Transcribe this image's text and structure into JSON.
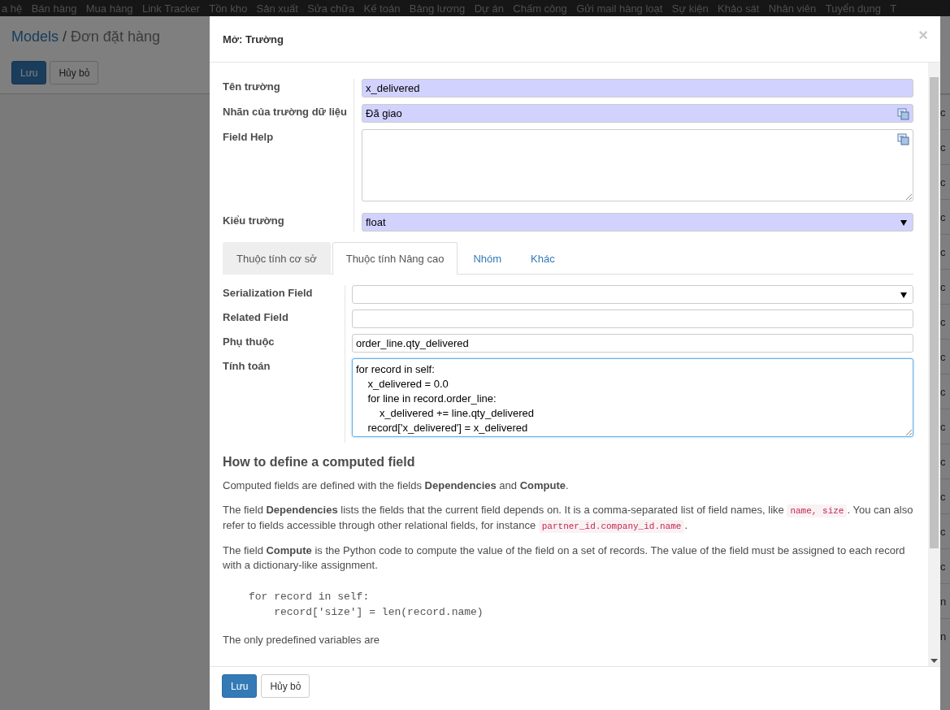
{
  "navbar": {
    "items": [
      "a hệ",
      "Bán hàng",
      "Mua hàng",
      "Link Tracker",
      "Tồn kho",
      "Sản xuất",
      "Sửa chữa",
      "Kế toán",
      "Bảng lương",
      "Dự án",
      "Chấm công",
      "Gửi mail hàng loạt",
      "Sự kiện",
      "Khảo sát",
      "Nhân viên",
      "Tuyển dụng",
      "T"
    ]
  },
  "breadcrumb": {
    "items": [
      {
        "label": "Models",
        "link": true
      },
      {
        "label": "Đơn đặt hàng",
        "link": false
      }
    ],
    "separator": "/"
  },
  "page_buttons": [
    {
      "label": "Lưu",
      "kind": "primary"
    },
    {
      "label": "Hủy bỏ",
      "kind": "secondary"
    }
  ],
  "list_rows": [
    "c",
    "c",
    "c",
    "c",
    "c",
    "c",
    "c",
    "c",
    "c",
    "c",
    "c",
    "c",
    "c",
    "c",
    "n",
    "n"
  ],
  "dialog": {
    "title": "Mở: Trường",
    "close": "×",
    "fields": [
      {
        "label": "Tên trường",
        "kind": "text",
        "value": "x_delivered",
        "required": true,
        "translatable": false
      },
      {
        "label": "Nhãn của trường dữ liệu",
        "kind": "text",
        "value": "Đã giao",
        "required": true,
        "translatable": true
      },
      {
        "label": "Field Help",
        "kind": "textarea",
        "required": false,
        "translatable": true
      },
      {
        "label": "Kiểu trường",
        "kind": "select",
        "value": "float",
        "required": true,
        "translatable": false
      }
    ],
    "tabs": [
      {
        "label": "Thuộc tính cơ sở",
        "selected": false,
        "hovered": true
      },
      {
        "label": "Thuộc tính Nâng cao",
        "selected": true,
        "hovered": false
      },
      {
        "label": "Nhóm",
        "selected": false,
        "hovered": false
      },
      {
        "label": "Khác",
        "selected": false,
        "hovered": false
      }
    ],
    "tab_fields": [
      {
        "label": "Serialization Field",
        "kind": "select",
        "focused": false
      },
      {
        "label": "Related Field",
        "kind": "text",
        "focused": false
      },
      {
        "label": "Phụ thuộc",
        "kind": "text",
        "value": "order_line.qty_delivered",
        "focused": false
      },
      {
        "label": "Tính toán",
        "kind": "textarea",
        "value": "for record in self:\n    x_delivered = 0.0\n    for line in record.order_line:\n        x_delivered += line.qty_delivered\n    record['x_delivered'] = x_delivered",
        "focused": true
      }
    ],
    "help": {
      "title": "How to define a computed field",
      "blocks": [
        {
          "kind": "paragraph",
          "parts": [
            {
              "text": "Computed fields are defined with the fields **Dependencies** and **Compute**."
            }
          ]
        },
        {
          "kind": "paragraph",
          "parts": [
            {
              "text": "The field **Dependencies** lists the fields that the current field depends on. It is a comma-separated list of field names, like "
            },
            {
              "code": "name, size"
            },
            {
              "text": ". You can also refer to fields accessible through other relational fields, for instance "
            },
            {
              "code": "partner_id.company_id.name"
            },
            {
              "text": "."
            }
          ]
        },
        {
          "kind": "paragraph",
          "parts": [
            {
              "text": "The field **Compute** is the Python code to compute the value of the field on a set of records. The value of the field must be assigned to each record with a dictionary-like assignment."
            }
          ]
        },
        {
          "kind": "code",
          "text": "for record in self:\n    record['size'] = len(record.name)"
        },
        {
          "kind": "paragraph",
          "parts": [
            {
              "text": "The only predefined variables are"
            }
          ]
        }
      ]
    },
    "buttons": [
      {
        "label": "Lưu",
        "kind": "primary"
      },
      {
        "label": "Hủy bỏ",
        "kind": "secondary"
      }
    ]
  }
}
